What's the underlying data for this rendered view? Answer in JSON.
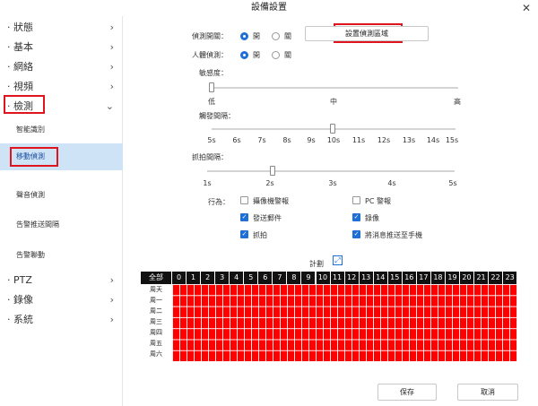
{
  "window": {
    "title": "設備設置",
    "close": "✕"
  },
  "sidebar": {
    "items": [
      {
        "label": "· 狀態",
        "chevron": "›"
      },
      {
        "label": "· 基本",
        "chevron": "›"
      },
      {
        "label": "· 網絡",
        "chevron": "›"
      },
      {
        "label": "· 視頻",
        "chevron": "›"
      },
      {
        "label": "· 檢測",
        "chevron": "⌄"
      },
      {
        "label": "· PTZ",
        "chevron": "›"
      },
      {
        "label": "· 錄像",
        "chevron": "›"
      },
      {
        "label": "· 系統",
        "chevron": "›"
      }
    ],
    "subitems": [
      "智能識別",
      "移動偵測",
      "聲音偵測",
      "告警推送間隔",
      "告警聯動"
    ]
  },
  "detection": {
    "switch_label": "偵測開關：",
    "human_label": "人體偵測：",
    "on": "開",
    "off": "關",
    "set_area_button": "設置偵測區域"
  },
  "sensitivity": {
    "label": "敏感度：",
    "ticks": [
      "低",
      "中",
      "高"
    ],
    "value": "低"
  },
  "trigger": {
    "label": "觸發間隔：",
    "ticks": [
      "5s",
      "6s",
      "7s",
      "8s",
      "9s",
      "10s",
      "11s",
      "12s",
      "13s",
      "14s",
      "15s"
    ],
    "value": "10s"
  },
  "snapshot": {
    "label": "抓拍間隔：",
    "ticks": [
      "1s",
      "2s",
      "3s",
      "4s",
      "5s"
    ],
    "value": "2s"
  },
  "actions": {
    "label": "行為：",
    "items": [
      {
        "label": "攝像機警報",
        "checked": false
      },
      {
        "label": "PC 警報",
        "checked": false
      },
      {
        "label": "發送郵件",
        "checked": true
      },
      {
        "label": "錄像",
        "checked": true
      },
      {
        "label": "抓拍",
        "checked": true
      },
      {
        "label": "將消息推送至手機",
        "checked": true
      }
    ]
  },
  "schedule": {
    "title": "計劃",
    "all_label": "全部",
    "hours": [
      "0",
      "1",
      "2",
      "3",
      "4",
      "5",
      "6",
      "7",
      "8",
      "9",
      "10",
      "11",
      "12",
      "13",
      "14",
      "15",
      "16",
      "17",
      "18",
      "19",
      "20",
      "21",
      "22",
      "23"
    ],
    "days": [
      "周天",
      "周一",
      "周二",
      "周三",
      "周四",
      "周五",
      "周六"
    ],
    "fill_color": "#ff0000"
  },
  "footer": {
    "save": "保存",
    "cancel": "取消"
  }
}
